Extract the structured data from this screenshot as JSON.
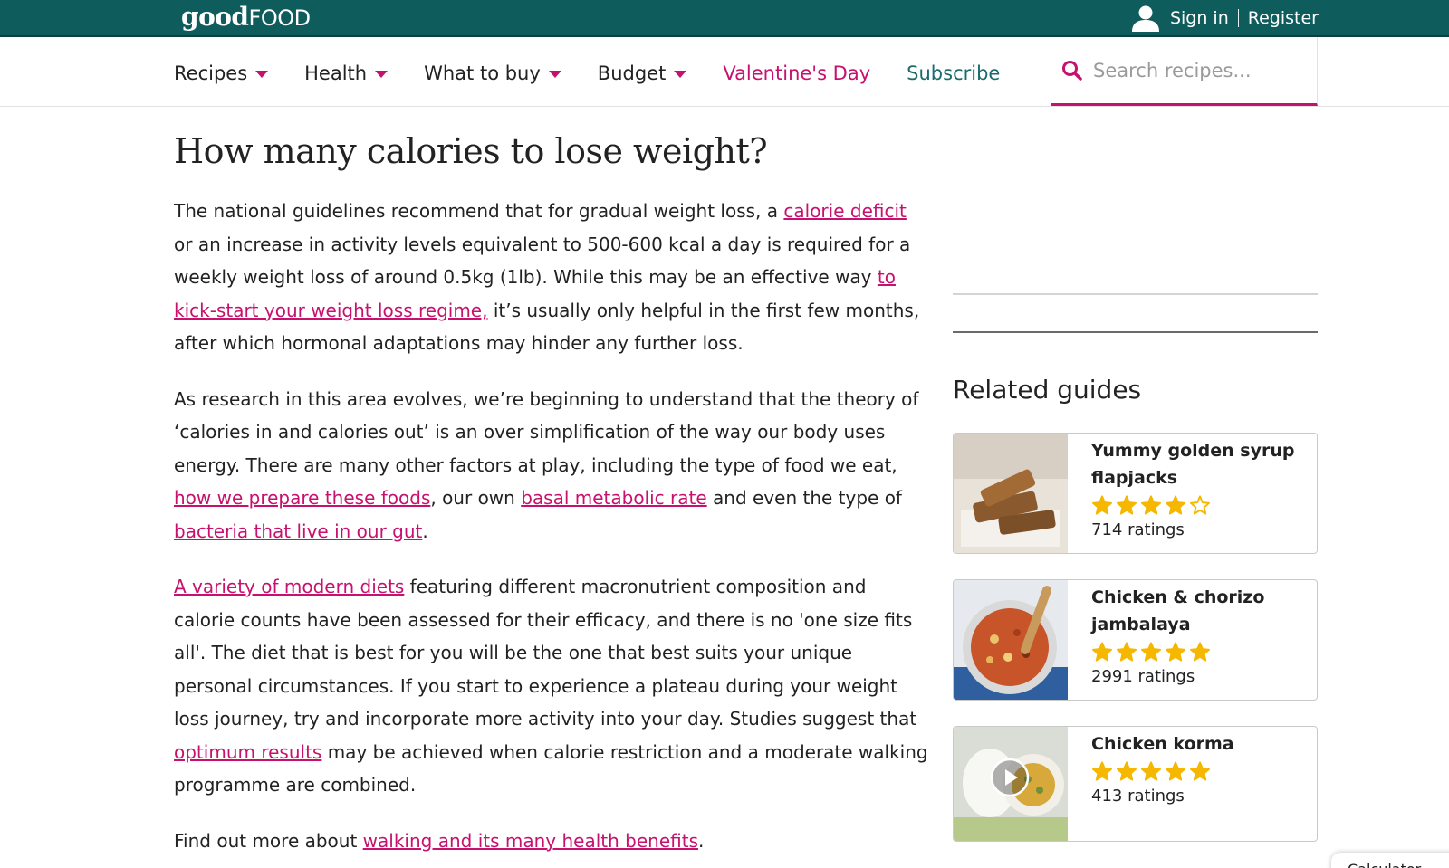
{
  "header": {
    "logo_bold": "good",
    "logo_light": "FOOD",
    "sign_in": "Sign in",
    "register": "Register"
  },
  "nav": {
    "items": [
      {
        "label": "Recipes"
      },
      {
        "label": "Health"
      },
      {
        "label": "What to buy"
      },
      {
        "label": "Budget"
      },
      {
        "label": "Valentine's Day"
      },
      {
        "label": "Subscribe"
      }
    ],
    "search_placeholder": "Search recipes..."
  },
  "article": {
    "title": "How many calories to lose weight?",
    "p1": {
      "t1": "The national guidelines recommend that for gradual weight loss, a ",
      "l1": "calorie deficit",
      "t2": " or an increase in activity levels equivalent to 500-600 kcal a day is required for a weekly weight loss of around 0.5kg (1lb). While this may be an effective way ",
      "l2": "to kick-start your weight loss regime,",
      "t3": " it’s usually only helpful in the first few months, after which hormonal adaptations may hinder any further loss."
    },
    "p2": {
      "t1": "As research in this area evolves, we’re beginning to understand that the theory of ‘calories in and calories out’ is an over simplification of the way our body uses energy. There are many other factors at play, including the type of food we eat, ",
      "l1": "how we prepare these foods",
      "t2": ", our own ",
      "l2": "basal metabolic rate",
      "t3": " and even the type of ",
      "l3": "bacteria that live in our gut",
      "t4": "."
    },
    "p3": {
      "l1": "A variety of modern diets",
      "t1": " featuring different macronutrient composition and calorie counts have been assessed for their efficacy, and there is no 'one size fits all'. The diet that is best for you will be the one that best suits your unique personal circumstances. If you start to experience a plateau during your weight loss journey, try and incorporate more activity into your day. Studies suggest that ",
      "l2": "optimum results",
      "t2": " may be achieved when calorie restriction and a moderate walking programme are combined."
    },
    "p4": {
      "t1": "Find out more about ",
      "l1": "walking and its many health benefits",
      "t2": "."
    }
  },
  "sidebar": {
    "related_title": "Related guides",
    "guides": [
      {
        "title": "Yummy golden syrup flapjacks",
        "stars": 4,
        "ratings": "714 ratings"
      },
      {
        "title": "Chicken & chorizo jambalaya",
        "stars": 5,
        "ratings": "2991 ratings"
      },
      {
        "title": "Chicken korma",
        "stars": 5,
        "ratings": "413 ratings"
      }
    ]
  },
  "calculator_tab": "Calculator",
  "colors": {
    "header_bg": "#0f5c5c",
    "accent_pink": "#c8116e",
    "subscribe_teal": "#1a6c6c",
    "star_gold": "#f5b700"
  }
}
